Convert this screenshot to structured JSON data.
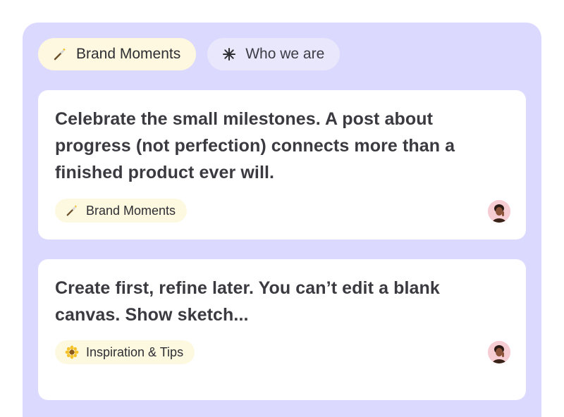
{
  "tabs": [
    {
      "label": "Brand Moments",
      "icon": "magic-wand-icon",
      "active": true
    },
    {
      "label": "Who we are",
      "icon": "asterisk-icon",
      "active": false
    }
  ],
  "cards": [
    {
      "text": "Celebrate the small milestones. A post about progress (not perfection) connects more than a finished product ever will.",
      "tag": {
        "label": "Brand Moments",
        "icon": "magic-wand-icon"
      },
      "avatar": "user-avatar"
    },
    {
      "text": "Create first, refine later. You can’t edit a blank canvas. Show sketch...",
      "tag": {
        "label": "Inspiration & Tips",
        "icon": "sunflower-icon"
      },
      "avatar": "user-avatar"
    }
  ],
  "colors": {
    "panel_bg": "#dcd9ff",
    "active_tab_bg": "#fdf8df",
    "inactive_tab_bg": "#e9e7fb",
    "tag_bg": "#fdf9e1",
    "card_text": "#3a3a40"
  }
}
